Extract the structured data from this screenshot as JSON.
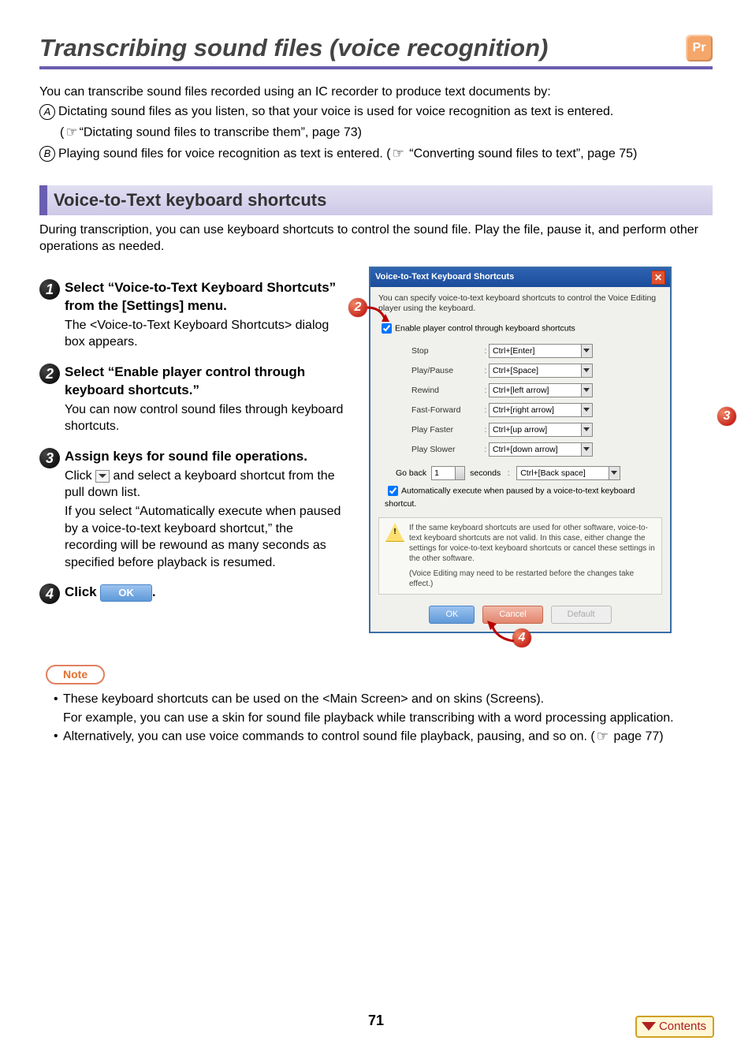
{
  "header": {
    "title": "Transcribing sound files (voice recognition)",
    "badge": "Pr"
  },
  "intro": {
    "lead": "You can transcribe sound files recorded using an IC recorder to produce text documents by:",
    "a_label": "A",
    "a_text": "Dictating sound files as you listen, so that your voice is used for voice recognition as text is entered.",
    "a_ref": "“Dictating sound files to transcribe them”, page 73)",
    "b_label": "B",
    "b_text_1": "Playing sound files for voice recognition as text is entered. (",
    "b_ref": "“Converting sound files to text”, page 75)"
  },
  "section": {
    "title": "Voice-to-Text keyboard shortcuts",
    "desc": "During transcription, you can use keyboard shortcuts to control the sound file. Play the file, pause it, and perform other operations as needed."
  },
  "steps": {
    "s1": {
      "head": "Select “Voice-to-Text Keyboard Shortcuts” from the [Settings] menu.",
      "body": "The <Voice-to-Text Keyboard Shortcuts> dialog box appears."
    },
    "s2": {
      "head": "Select “Enable player control through keyboard shortcuts.”",
      "body": "You can now control sound files through keyboard shortcuts."
    },
    "s3": {
      "head": "Assign keys for sound file operations.",
      "body1_pre": "Click ",
      "body1_post": " and select a keyboard shortcut from the pull down list.",
      "body2": "If you select “Automatically execute when paused by a voice-to-text keyboard shortcut,” the recording will be rewound as many seconds as specified before playback is resumed."
    },
    "s4": {
      "head_pre": "Click ",
      "head_post": "."
    }
  },
  "dialog": {
    "title": "Voice-to-Text Keyboard Shortcuts",
    "desc": "You can specify voice-to-text keyboard shortcuts to control the Voice Editing player using the keyboard.",
    "enable_label": "Enable player control through keyboard shortcuts",
    "rows": [
      {
        "label": "Stop",
        "value": "Ctrl+[Enter]"
      },
      {
        "label": "Play/Pause",
        "value": "Ctrl+[Space]"
      },
      {
        "label": "Rewind",
        "value": "Ctrl+[left arrow]"
      },
      {
        "label": "Fast-Forward",
        "value": "Ctrl+[right arrow]"
      },
      {
        "label": "Play Faster",
        "value": "Ctrl+[up arrow]"
      },
      {
        "label": "Play Slower",
        "value": "Ctrl+[down arrow]"
      }
    ],
    "goback_label": "Go back",
    "goback_value": "1",
    "goback_unit": "seconds",
    "goback_dd": "Ctrl+[Back space]",
    "auto_label": "Automatically execute when paused by a voice-to-text keyboard shortcut.",
    "warn1": "If the same keyboard shortcuts are used for other software, voice-to-text keyboard shortcuts are not valid. In this case, either change the settings for voice-to-text keyboard shortcuts or cancel these settings in the other software.",
    "warn2": "(Voice Editing may need to be restarted before the changes take effect.)",
    "ok": "OK",
    "cancel": "Cancel",
    "default": "Default"
  },
  "note": {
    "label": "Note",
    "n1": "These keyboard shortcuts can be used on the <Main Screen> and on skins (Screens).",
    "n1b": "For example, you can use a skin for sound file playback while transcribing with a word processing application.",
    "n2_pre": "Alternatively, you can use voice commands to control sound file playback, pausing, and so on. (",
    "n2_post": " page 77)"
  },
  "footer": {
    "page": "71",
    "contents": "Contents"
  },
  "misc": {
    "ok_inline": "OK"
  }
}
